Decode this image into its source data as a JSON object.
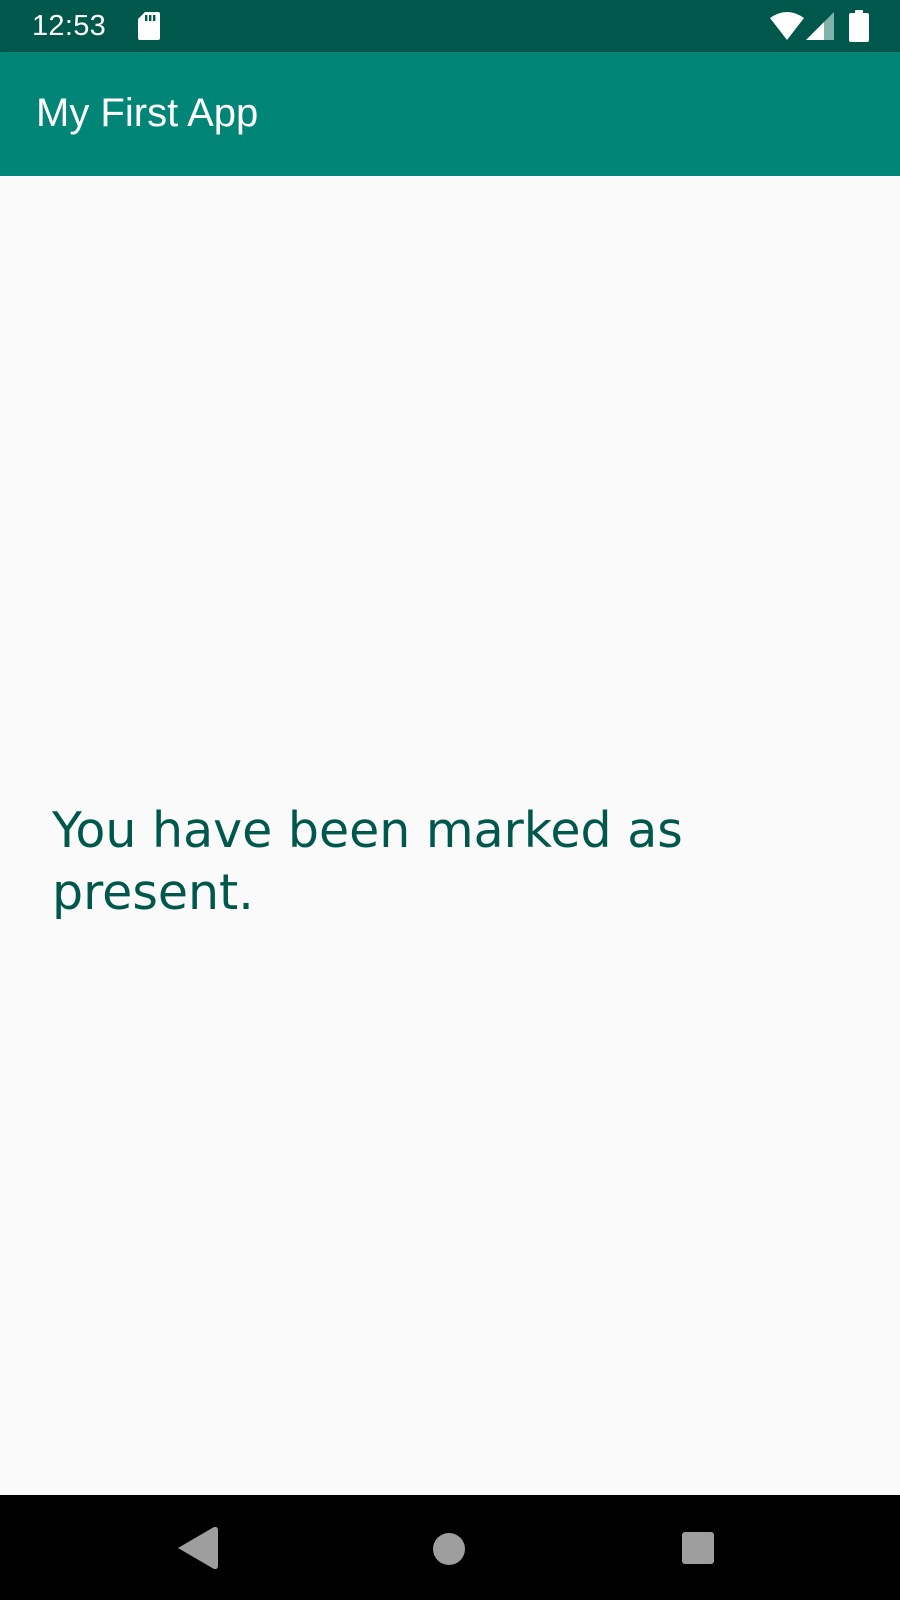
{
  "status_bar": {
    "time": "12:53",
    "icons": [
      "sd-card-icon",
      "wifi-icon",
      "cell-signal-icon",
      "battery-icon"
    ]
  },
  "app_bar": {
    "title": "My First App"
  },
  "content": {
    "message": "You have been marked as present."
  },
  "nav_bar": {
    "buttons": [
      "back-icon",
      "home-icon",
      "recents-icon"
    ]
  },
  "colors": {
    "status_bar": "#00574b",
    "app_bar": "#008577",
    "background": "#fafafa",
    "message_text": "#00574b",
    "nav_bar": "#000000",
    "nav_icons": "#9e9e9e"
  }
}
